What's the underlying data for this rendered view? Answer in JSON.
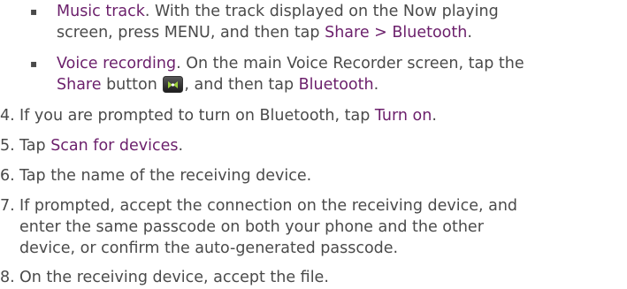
{
  "bullets": [
    {
      "term": "Music track",
      "after_term": ". With the track displayed on the Now playing",
      "line2_a": "screen, press MENU, and then tap ",
      "kw1": "Share > Bluetooth",
      "line2_end": "."
    },
    {
      "term": "Voice recording",
      "after_term": ". On the main Voice Recorder screen, tap the",
      "kw1": "Share",
      "line2_a": " button ",
      "line2_b": ", and then tap ",
      "kw2": "Bluetooth",
      "line2_end": "."
    }
  ],
  "steps": [
    {
      "num": "4.",
      "text_a": "If you are prompted to turn on Bluetooth, tap ",
      "kw": "Turn on",
      "text_end": "."
    },
    {
      "num": "5.",
      "text_a": "Tap ",
      "kw": "Scan for devices",
      "text_end": "."
    },
    {
      "num": "6.",
      "text_a": "Tap the name of the receiving device."
    },
    {
      "num": "7.",
      "line1": "If prompted, accept the connection on the receiving device, and",
      "line2": "enter the same passcode on both your phone and the other",
      "line3": "device, or confirm the auto-generated passcode."
    },
    {
      "num": "8.",
      "text_a": "On the receiving device, accept the file."
    }
  ],
  "icons": {
    "share": "share-icon"
  },
  "colors": {
    "text": "#4a4a4a",
    "keyword": "#6b1f6b"
  }
}
